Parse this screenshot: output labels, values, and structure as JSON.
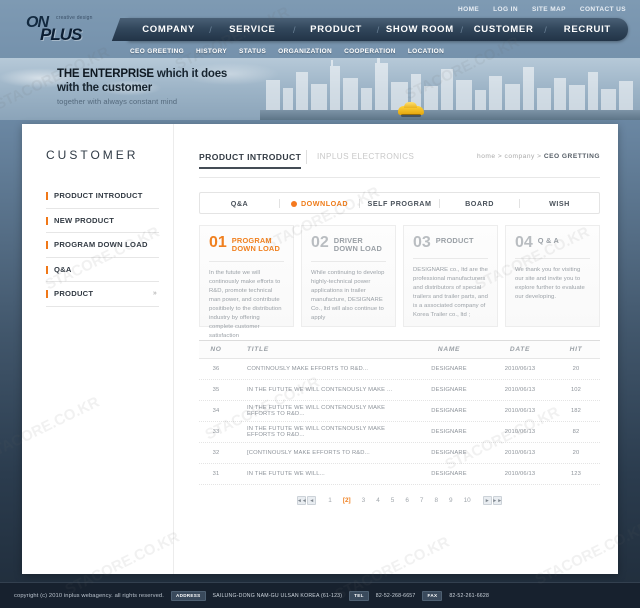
{
  "brand": {
    "logo_line1": "ON",
    "logo_tagline": "creative design",
    "logo_line2": "PLUS"
  },
  "util_nav": [
    {
      "label": "HOME"
    },
    {
      "label": "LOG IN"
    },
    {
      "label": "SITE MAP"
    },
    {
      "label": "CONTACT US"
    }
  ],
  "main_nav": [
    {
      "label": "COMPANY"
    },
    {
      "label": "SERVICE"
    },
    {
      "label": "PRODUCT"
    },
    {
      "label": "SHOW ROOM"
    },
    {
      "label": "CUSTOMER"
    },
    {
      "label": "RECRUIT"
    }
  ],
  "sub_nav": [
    {
      "label": "CEO GREETING"
    },
    {
      "label": "HISTORY"
    },
    {
      "label": "STATUS"
    },
    {
      "label": "ORGANIZATION"
    },
    {
      "label": "COOPERATION"
    },
    {
      "label": "LOCATION"
    }
  ],
  "hero": {
    "line1a": "THE ENTERPRISE",
    "line1b": " which it does",
    "line2": "with the customer",
    "line3": "together with always constant mind"
  },
  "sidebar": {
    "title": "CUSTOMER",
    "items": [
      {
        "label": "PRODUCT INTRODUCT",
        "arrow": ""
      },
      {
        "label": "NEW PRODUCT",
        "arrow": ""
      },
      {
        "label": "PROGRAM DOWN LOAD",
        "arrow": ""
      },
      {
        "label": "Q&A",
        "arrow": ""
      },
      {
        "label": "PRODUCT",
        "arrow": "»"
      }
    ]
  },
  "page_head": {
    "title": "PRODUCT INTRODUCT",
    "subtitle": "INPLUS ELECTRONICS",
    "breadcrumb_prefix": "home  >  company  >  ",
    "breadcrumb_current": "CEO GRETTING"
  },
  "tabs": [
    {
      "label": "Q&A",
      "active": false
    },
    {
      "label": "DOWNLOAD",
      "active": true
    },
    {
      "label": "SELF PROGRAM",
      "active": false
    },
    {
      "label": "BOARD",
      "active": false
    },
    {
      "label": "WISH",
      "active": false
    }
  ],
  "cards": [
    {
      "num": "01",
      "label_l1": "PROGRAM",
      "label_l2": "DOWN LOAD",
      "body": "In the futute we will continously make efforts to R&D, promote technical man power, and contribute positibely to the distribution industry by offering complete customer satisfaction",
      "highlight": true
    },
    {
      "num": "02",
      "label_l1": "DRIVER",
      "label_l2": "DOWN LOAD",
      "body": "While continuing to develop highly-technical power applications in trailer manufacture, DESIGNARE Co., ltd will also continue to apply",
      "highlight": false
    },
    {
      "num": "03",
      "label_l1": "PRODUCT",
      "label_l2": "",
      "body": "DESIGNARE co., ltd are the professional manufacturers and distributors of special trailers and trailer parts, and is a associated company of Korea Trailer co., ltd ;",
      "highlight": false
    },
    {
      "num": "04",
      "label_l1": "Q & A",
      "label_l2": "",
      "body": "We thank you for visiting our site and invite you to explore further to evaluate our developing.",
      "highlight": false
    }
  ],
  "table": {
    "headers": [
      "NO",
      "TITLE",
      "NAME",
      "DATE",
      "HIT"
    ],
    "rows": [
      {
        "no": "36",
        "title": "CONTINOUSLY MAKE EFFORTS TO R&D...",
        "name": "DESIGNARE",
        "date": "2010/06/13",
        "hit": "20"
      },
      {
        "no": "35",
        "title": "IN THE FUTUTE WE WILL CONTENOUSLY MAKE ...",
        "name": "DESIGNARE",
        "date": "2010/06/13",
        "hit": "102"
      },
      {
        "no": "34",
        "title": "IN THE FUTUTE WE WILL CONTENOUSLY MAKE EFFORTS TO R&D...",
        "name": "DESIGNARE",
        "date": "2010/06/13",
        "hit": "182"
      },
      {
        "no": "33",
        "title": "IN THE FUTUTE WE WILL CONTENOUSLY MAKE EFFORTS TO R&D...",
        "name": "DESIGNARE",
        "date": "2010/06/13",
        "hit": "82"
      },
      {
        "no": "32",
        "title": "[CONTINOUSLY MAKE EFFORTS TO R&D...",
        "name": "DESIGNARE",
        "date": "2010/06/13",
        "hit": "20"
      },
      {
        "no": "31",
        "title": "IN THE FUTUTE WE WILL...",
        "name": "DESIGNARE",
        "date": "2010/06/13",
        "hit": "123"
      }
    ]
  },
  "pagination": {
    "first": "◄◄",
    "prev": "◄",
    "pages": [
      "1",
      "[2]",
      "3",
      "4",
      "5",
      "6",
      "7",
      "8",
      "9",
      "10"
    ],
    "active_page": "[2]",
    "next": "►",
    "last": "►►"
  },
  "footer": {
    "copyright": "copyright (c) 2010 inplus webagency. all rights reserved.",
    "address_label": "ADDRESS",
    "address_value": "SAILUNG-DONG NAM-GU ULSAN KOREA  (61-123)",
    "tel_label": "TEL",
    "tel_value": "82-52-268-6657",
    "fax_label": "FAX",
    "fax_value": "82-52-261-6628"
  },
  "colors": {
    "accent": "#f0801f",
    "nav_dark": "#32475c",
    "footer_bg": "#17212e"
  },
  "watermark": {
    "text": "STACORE.CO.KR"
  }
}
